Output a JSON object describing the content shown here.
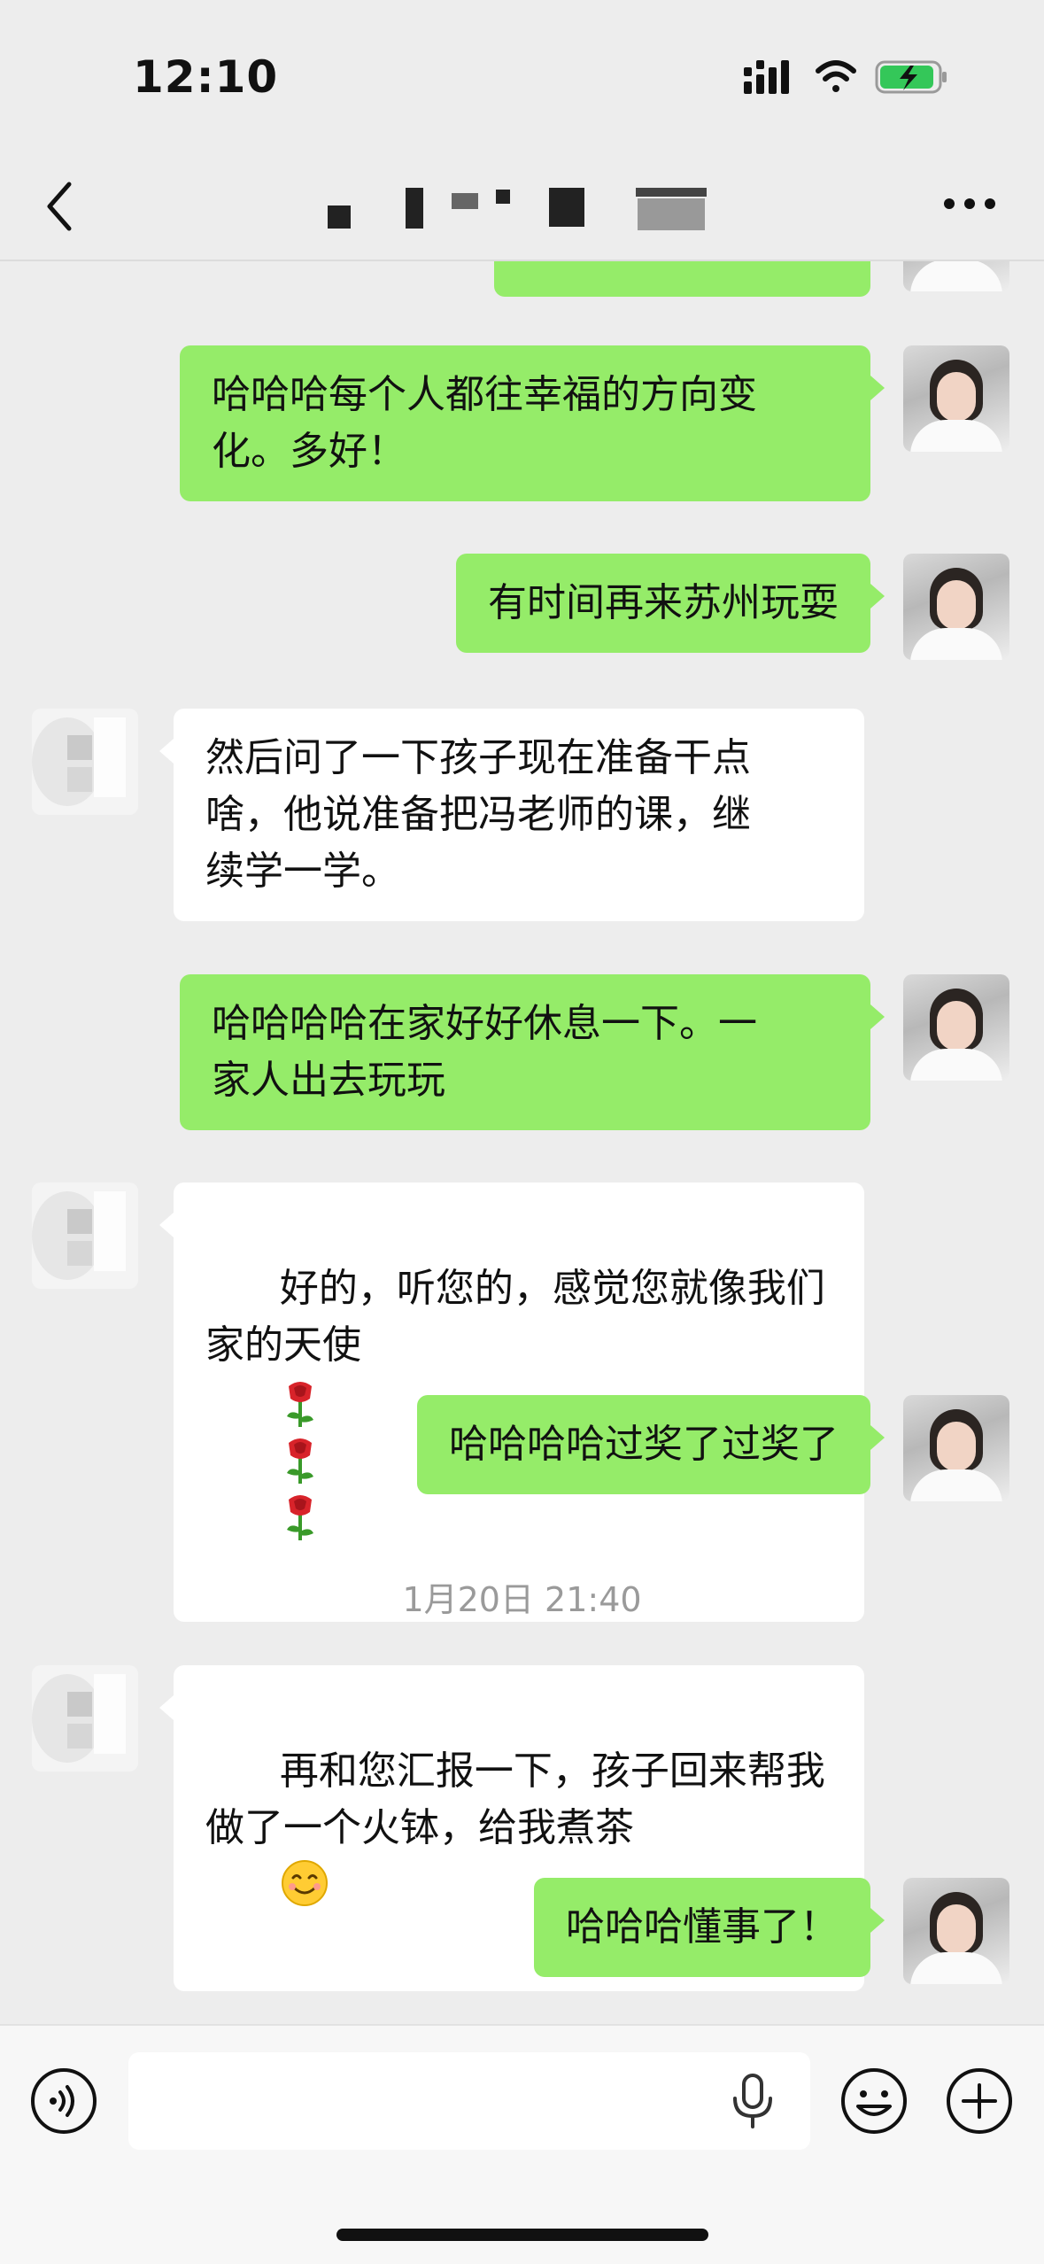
{
  "status_bar": {
    "time": "12:10",
    "icons": [
      "signal-icon",
      "wifi-icon",
      "battery-charging-icon"
    ]
  },
  "nav": {
    "back_icon": "chevron-left-icon",
    "title_redacted": true,
    "more_icon": "more-icon"
  },
  "messages": [
    {
      "side": "mine",
      "text": ""
    },
    {
      "side": "mine",
      "text": "哈哈哈每个人都往幸福的方向变\n化。多好！"
    },
    {
      "side": "mine",
      "text": "有时间再来苏州玩耍"
    },
    {
      "side": "theirs",
      "text": "然后问了一下孩子现在准备干点\n啥，他说准备把冯老师的课，继\n续学一学。"
    },
    {
      "side": "mine",
      "text": "哈哈哈哈在家好好休息一下。一\n家人出去玩玩"
    },
    {
      "side": "theirs",
      "text": "好的，听您的，感觉您就像我们\n家的天使"
    },
    {
      "side": "mine",
      "text": "哈哈哈哈过奖了过奖了"
    },
    {
      "side": "theirs",
      "text": "再和您汇报一下，孩子回来帮我\n做了一个火钵，给我煮茶"
    },
    {
      "side": "mine",
      "text": "哈哈哈懂事了！"
    }
  ],
  "timestamp": "1月20日 21:40",
  "emojis": {
    "roses": [
      "rose-emoji",
      "rose-emoji",
      "rose-emoji"
    ],
    "smile": "smiling-face-emoji"
  },
  "input_bar": {
    "voice_icon": "voice-mode-icon",
    "input_placeholder": "",
    "mic_icon": "microphone-icon",
    "emoji_icon": "emoji-icon",
    "plus_icon": "plus-icon"
  },
  "colors": {
    "background": "#ededed",
    "my_bubble": "#95ec69",
    "their_bubble": "#ffffff",
    "timestamp_text": "#9a9a9a"
  }
}
